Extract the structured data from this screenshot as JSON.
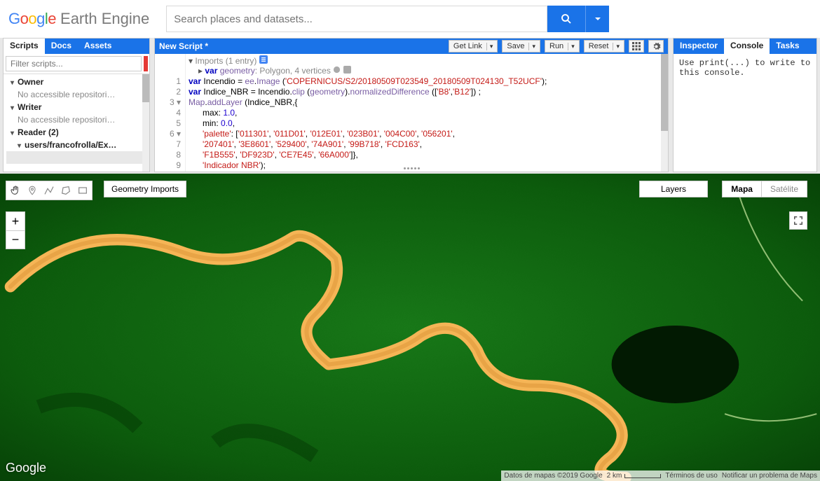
{
  "logo": {
    "g_b": "G",
    "g_r1": "o",
    "g_y": "o",
    "g_b2": "g",
    "g_g": "l",
    "g_r2": "e",
    "product": "Earth Engine"
  },
  "search": {
    "placeholder": "Search places and datasets..."
  },
  "left": {
    "tabs": {
      "scripts": "Scripts",
      "docs": "Docs",
      "assets": "Assets"
    },
    "filter_placeholder": "Filter scripts...",
    "owner": "Owner",
    "owner_msg": "No accessible repositori…",
    "writer": "Writer",
    "writer_msg": "No accessible repositori…",
    "reader": "Reader  (2)",
    "user": "users/francofrolla/Ex…"
  },
  "editor": {
    "title": "New Script *",
    "btn_getlink": "Get Link",
    "btn_save": "Save",
    "btn_run": "Run",
    "btn_reset": "Reset",
    "imports_label": "Imports (1 entry)",
    "imports_line": "var geometry: Polygon, 4 vertices",
    "line1a": "var",
    "line1b": " Incendio = ",
    "line1c": "ee",
    "line1d": ".",
    "line1e": "Image",
    "line1f": " (",
    "line1g": "'COPERNICUS/S2/20180509T023549_20180509T024130_T52UCF'",
    "line1h": ");",
    "line2a": "var",
    "line2b": " Indice_NBR = Incendio.",
    "line2c": "clip",
    "line2d": " (",
    "line2e": "geometry",
    "line2f": ").",
    "line2g": "normalizedDifference",
    "line2h": " ([",
    "line2i": "'B8'",
    "line2j": ",",
    "line2k": "'B12'",
    "line2l": "]) ;",
    "line3a": "Map",
    "line3b": ".",
    "line3c": "addLayer",
    "line3d": " (Indice_NBR,{",
    "line4a": "      max: ",
    "line4b": "1.0",
    "line4c": ",",
    "line5a": "      min: ",
    "line5b": "0.0",
    "line5c": ",",
    "line6a": "      ",
    "line6b": "'palette'",
    "line6c": ": [",
    "line6d": "'011301'",
    "line6e": ", ",
    "line6f": "'011D01'",
    "line6g": ", ",
    "line6h": "'012E01'",
    "line6i": ", ",
    "line6j": "'023B01'",
    "line6k": ", ",
    "line6l": "'004C00'",
    "line6m": ", ",
    "line6n": "'056201'",
    "line6o": ",",
    "line7a": "      ",
    "line7b": "'207401'",
    "line7c": ", ",
    "line7d": "'3E8601'",
    "line7e": ", ",
    "line7f": "'529400'",
    "line7g": ", ",
    "line7h": "'74A901'",
    "line7i": ", ",
    "line7j": "'99B718'",
    "line7k": ", ",
    "line7l": "'FCD163'",
    "line7m": ",",
    "line8a": "      ",
    "line8b": "'F1B555'",
    "line8c": ", ",
    "line8d": "'DF923D'",
    "line8e": ", ",
    "line8f": "'CE7E45'",
    "line8g": ", ",
    "line8h": "'66A000'",
    "line8i": "]},",
    "line9a": "      ",
    "line9b": "'Indicador NBR'",
    "line9c": ");"
  },
  "right": {
    "tabs": {
      "inspector": "Inspector",
      "console": "Console",
      "tasks": "Tasks"
    },
    "console_msg": "Use print(...) to write to this console."
  },
  "map": {
    "geometry_imports": "Geometry Imports",
    "layers": "Layers",
    "mapa": "Mapa",
    "satelite": "Satélite",
    "footer_logo": "Google",
    "attrib_data": "Datos de mapas ©2019 Google",
    "attrib_scale": "2 km",
    "attrib_terms": "Términos de uso",
    "attrib_report": "Notificar un problema de Maps"
  }
}
